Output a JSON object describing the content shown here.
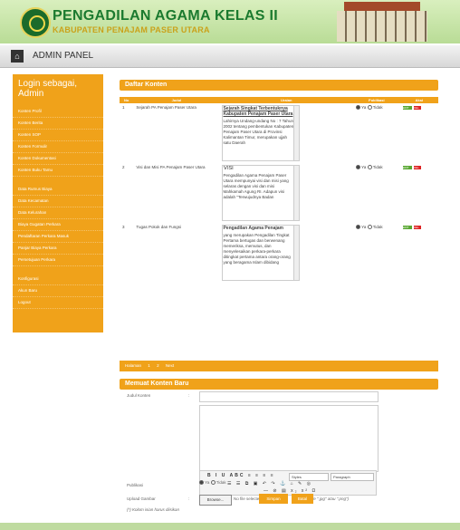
{
  "header": {
    "title": "PENGADILAN AGAMA KELAS II",
    "subtitle": "KABUPATEN PENAJAM PASER UTARA"
  },
  "admin": {
    "title": "ADMIN PANEL"
  },
  "sidebar": {
    "login": "Login sebagai, Admin",
    "items": [
      "Konten Profil",
      "Konten Berita",
      "Konten SOP",
      "Konten Formulir",
      "Konten Dokumentasi",
      "Konten Buku Tamu",
      "Data Rumus Biaya",
      "Data Kecamatan",
      "Data Kelurahan",
      "Biaya Gugatan Perkara",
      "Pendaftaran Perkara Masuk",
      "Panjar Biaya Perkara",
      "Persetujuan Perkara",
      "Konfigurasi",
      "Akun Baru",
      "Logout"
    ]
  },
  "daftar": {
    "title": "Daftar Konten",
    "headers": {
      "no": "No",
      "judul": "Judul",
      "uraian": "Uraian",
      "publikasi": "Publikasi",
      "aksi": "Aksi"
    },
    "rows": [
      {
        "no": "1",
        "judul": "Sejarah PA Penajam Paser Utara",
        "heading": "Sejarah Singkat Terbentuknya Kabupaten Penajam Paser Utara",
        "text": "Lahirnya Undang-undang No : 7 Tahun 2002 tentang pembentukan Kabupaten Penajam Paser Utara di Provinsi Kalimantan Timur, merupakan ujjah satu Daerah",
        "pub_yes": "Ya",
        "pub_no": "Tidak",
        "edit": "EDIT",
        "del": "DEL"
      },
      {
        "no": "2",
        "judul": "Visi dan Misi PA Penajam Paser Utara",
        "heading": "Visi",
        "text": "Pengadilan Agama Penajam Paser Utara mempunyai visi dan misi yang selaras dengan visi dan misi Mahkamah Agung RI. Adapun visi adalah \"Terwujudnya Badan",
        "pub_yes": "Ya",
        "pub_no": "Tidak",
        "edit": "EDIT",
        "del": "DEL"
      },
      {
        "no": "3",
        "judul": "Tugas Pokok dan Fungsi",
        "heading": "Pengadilan Agama Penajam",
        "text": "yang merupakan Pengadilan Tingkat Pertama bertugas dan berwenang memeriksa, memutus, dan menyelesaikan perkara-perkara ditingkat pertama antara orang-orang yang beragama Islam dibidang",
        "pub_yes": "Ya",
        "pub_no": "Tidak",
        "edit": "EDIT",
        "del": "DEL"
      }
    ],
    "pager": {
      "label": "Halaman",
      "page1": "1",
      "page2": "2",
      "next": "Next"
    }
  },
  "form": {
    "title": "Memuat Konten Baru",
    "judul_label": "Judul Konten",
    "sep": ":",
    "editor_styles": "Styles",
    "editor_paragraph": "Paragraph",
    "publikasi_label": "Publikasi",
    "publikasi_yes": "Ya",
    "publikasi_no": "Tidak",
    "upload_label": "Upload Gambar",
    "upload_button": "Browse...",
    "upload_status": "No file selected.",
    "upload_hint": "(File \".jpg\" atau \".png\")",
    "required_note": "(*) Kolom isian harus diisikan",
    "save": "Simpan",
    "cancel": "Batal"
  }
}
